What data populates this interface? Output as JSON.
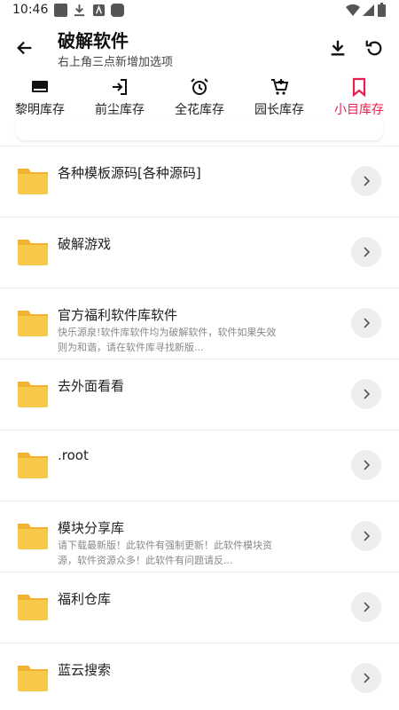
{
  "status_bar": {
    "time": "10:46"
  },
  "header": {
    "title": "破解软件",
    "subtitle": "右上角三点新增加选项"
  },
  "tabs": [
    {
      "label": "黎明库存",
      "icon": "keyboard-icon",
      "active": false
    },
    {
      "label": "前尘库存",
      "icon": "login-icon",
      "active": false
    },
    {
      "label": "全花库存",
      "icon": "alarm-icon",
      "active": false
    },
    {
      "label": "园长库存",
      "icon": "cart-icon",
      "active": false
    },
    {
      "label": "小目库存",
      "icon": "bookmark-icon",
      "active": true
    }
  ],
  "colors": {
    "accent": "#e8204f",
    "folder": "#f7c948",
    "folder_back": "#f2b233"
  },
  "items": [
    {
      "title": "各种模板源码[各种源码]",
      "desc": ""
    },
    {
      "title": "破解游戏",
      "desc": ""
    },
    {
      "title": "官方福利软件库软件",
      "desc": "快乐源泉!软件库软件均为破解软件，软件如果失效则为和谐，请在软件库寻找新版..."
    },
    {
      "title": "去外面看看",
      "desc": ""
    },
    {
      "title": ".root",
      "desc": ""
    },
    {
      "title": "模块分享库",
      "desc": "请下载最新版！此软件有强制更新！此软件模块资源，软件资源众多！此软件有问题请反..."
    },
    {
      "title": "福利仓库",
      "desc": ""
    },
    {
      "title": "蓝云搜索",
      "desc": ""
    }
  ]
}
